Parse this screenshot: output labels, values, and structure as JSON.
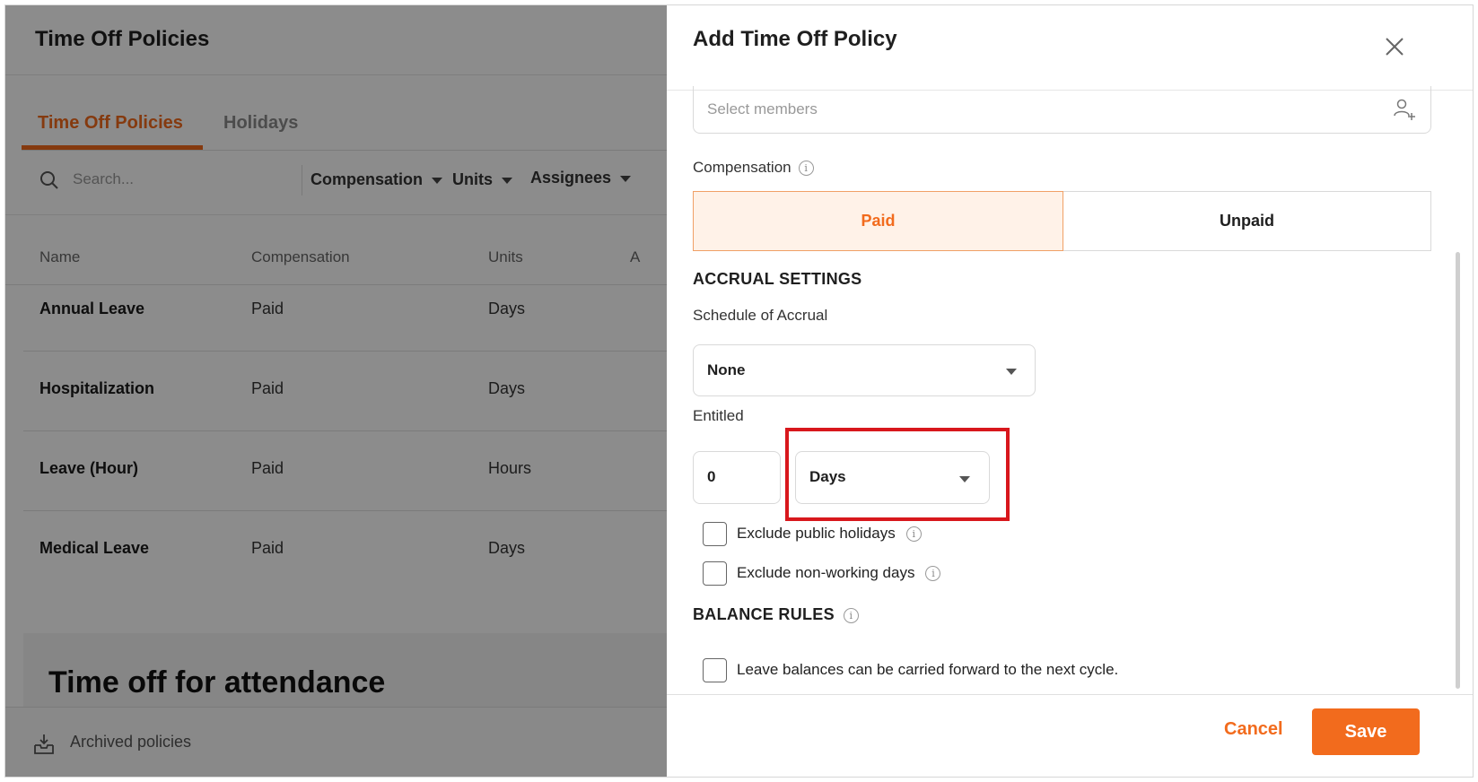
{
  "background": {
    "title": "Time Off Policies",
    "tabs": [
      "Time Off Policies",
      "Holidays"
    ],
    "search_placeholder": "Search...",
    "filters": [
      "Compensation",
      "Units",
      "Assignees"
    ],
    "columns": [
      "Name",
      "Compensation",
      "Units",
      "A"
    ],
    "rows": [
      {
        "name": "Annual Leave",
        "compensation": "Paid",
        "units": "Days"
      },
      {
        "name": "Hospitalization",
        "compensation": "Paid",
        "units": "Days"
      },
      {
        "name": "Leave (Hour)",
        "compensation": "Paid",
        "units": "Hours"
      },
      {
        "name": "Medical Leave",
        "compensation": "Paid",
        "units": "Days"
      }
    ],
    "promo_title": "Time off for attendance",
    "archived_label": "Archived policies"
  },
  "panel": {
    "title": "Add Time Off Policy",
    "members_placeholder": "Select members",
    "compensation_label": "Compensation",
    "compensation_options": [
      "Paid",
      "Unpaid"
    ],
    "compensation_selected": "Paid",
    "accrual_section": "ACCRUAL SETTINGS",
    "schedule_label": "Schedule of Accrual",
    "schedule_value": "None",
    "entitled_label": "Entitled",
    "entitled_value": "0",
    "entitled_unit": "Days",
    "exclude_holidays_label": "Exclude public holidays",
    "exclude_nonworking_label": "Exclude non-working days",
    "balance_section": "BALANCE RULES",
    "carry_forward_label": "Leave balances can be carried forward to the next cycle.",
    "cancel_label": "Cancel",
    "save_label": "Save"
  },
  "colors": {
    "accent": "#f26b1d",
    "highlight": "#d8171c",
    "paid_bg": "#fff2e8"
  },
  "icons": [
    "search-icon",
    "caret-down-icon",
    "close-icon",
    "add-user-icon",
    "info-icon",
    "archive-icon"
  ]
}
